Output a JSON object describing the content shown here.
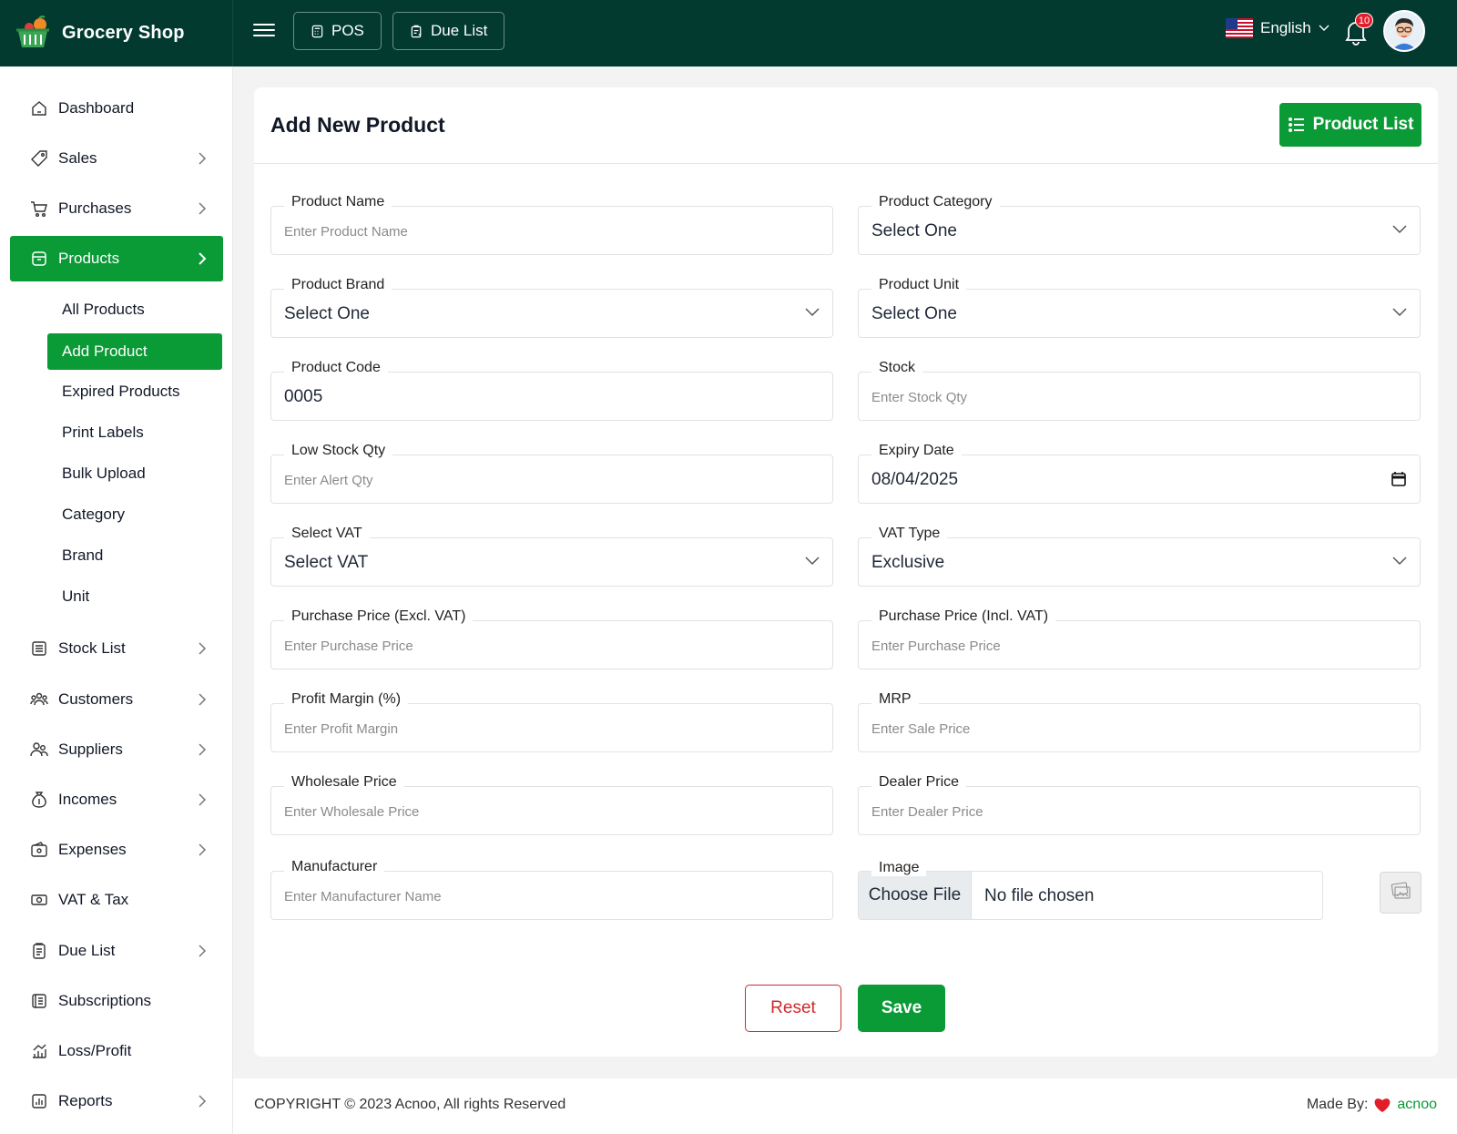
{
  "brand": {
    "name": "Grocery Shop"
  },
  "topbar": {
    "pos_label": "POS",
    "due_list_label": "Due List",
    "language": "English",
    "notification_count": "10"
  },
  "sidebar": {
    "items": [
      {
        "label": "Dashboard"
      },
      {
        "label": "Sales"
      },
      {
        "label": "Purchases"
      },
      {
        "label": "Products"
      },
      {
        "label": "Stock List"
      },
      {
        "label": "Customers"
      },
      {
        "label": "Suppliers"
      },
      {
        "label": "Incomes"
      },
      {
        "label": "Expenses"
      },
      {
        "label": "VAT & Tax"
      },
      {
        "label": "Due List"
      },
      {
        "label": "Subscriptions"
      },
      {
        "label": "Loss/Profit"
      },
      {
        "label": "Reports"
      }
    ],
    "products_sub": [
      {
        "label": "All Products"
      },
      {
        "label": "Add Product"
      },
      {
        "label": "Expired Products"
      },
      {
        "label": "Print Labels"
      },
      {
        "label": "Bulk Upload"
      },
      {
        "label": "Category"
      },
      {
        "label": "Brand"
      },
      {
        "label": "Unit"
      }
    ]
  },
  "page": {
    "title": "Add New Product",
    "product_list_button": "Product List"
  },
  "form": {
    "product_name": {
      "label": "Product Name",
      "placeholder": "Enter Product Name"
    },
    "product_category": {
      "label": "Product Category",
      "value": "Select One"
    },
    "product_brand": {
      "label": "Product Brand",
      "value": "Select One"
    },
    "product_unit": {
      "label": "Product Unit",
      "value": "Select One"
    },
    "product_code": {
      "label": "Product Code",
      "value": "0005"
    },
    "stock": {
      "label": "Stock",
      "placeholder": "Enter Stock Qty"
    },
    "low_stock": {
      "label": "Low Stock Qty",
      "placeholder": "Enter Alert Qty"
    },
    "expiry_date": {
      "label": "Expiry Date",
      "value": "08/04/2025"
    },
    "select_vat": {
      "label": "Select VAT",
      "value": "Select VAT"
    },
    "vat_type": {
      "label": "VAT Type",
      "value": "Exclusive"
    },
    "purchase_excl": {
      "label": "Purchase Price (Excl. VAT)",
      "placeholder": "Enter Purchase Price"
    },
    "purchase_incl": {
      "label": "Purchase Price (Incl. VAT)",
      "placeholder": "Enter Purchase Price"
    },
    "profit_margin": {
      "label": "Profit Margin (%)",
      "placeholder": "Enter Profit Margin"
    },
    "mrp": {
      "label": "MRP",
      "placeholder": "Enter Sale Price"
    },
    "wholesale": {
      "label": "Wholesale Price",
      "placeholder": "Enter Wholesale Price"
    },
    "dealer": {
      "label": "Dealer Price",
      "placeholder": "Enter Dealer Price"
    },
    "manufacturer": {
      "label": "Manufacturer",
      "placeholder": "Enter Manufacturer Name"
    },
    "image": {
      "label": "Image",
      "choose_label": "Choose File",
      "status": "No file chosen"
    },
    "reset_label": "Reset",
    "save_label": "Save"
  },
  "footer": {
    "copyright": "COPYRIGHT © 2023 Acnoo, All rights Reserved",
    "made_by": "Made By:",
    "author": "acnoo"
  },
  "colors": {
    "topbar": "#023a30",
    "accent": "#0a9a36",
    "danger": "#d02a2a"
  },
  "icons": [
    "basket-logo-icon",
    "menu-icon",
    "calculator-icon",
    "clipboard-icon",
    "us-flag-icon",
    "bell-icon",
    "avatar",
    "chevron-right-icon",
    "chevron-down-icon",
    "calendar-icon",
    "list-icon",
    "heart-icon"
  ]
}
